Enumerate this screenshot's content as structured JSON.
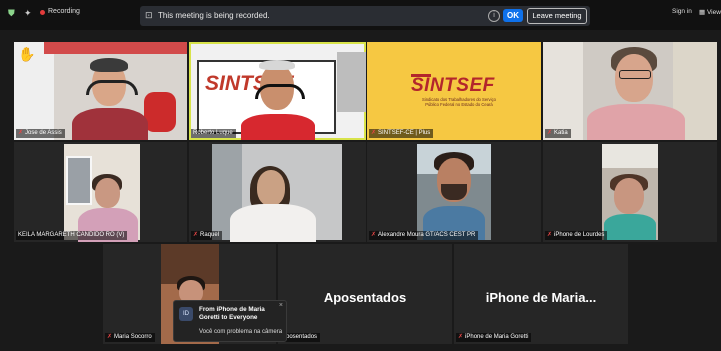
{
  "topbar": {
    "recording_label": "Recording",
    "banner_text": "This meeting is being recorded.",
    "ok_label": "OK",
    "leave_label": "Leave meeting",
    "signin_label": "Sign in",
    "view_label": "View"
  },
  "participants": [
    {
      "name": "Jose de Assis"
    },
    {
      "name": "Roberto Luque"
    },
    {
      "name": "SINTSEF-CE | Plus"
    },
    {
      "name": "Katia"
    },
    {
      "name": "KEILA MARGARETH CANDIDO RO (V)"
    },
    {
      "name": "Raquel"
    },
    {
      "name": "Alexandre Moura GT/ACS CEST PR"
    },
    {
      "name": "iPhone de Lourdes"
    },
    {
      "name": "Maria Socorro"
    },
    {
      "name": "Aposentados",
      "display": "Aposentados"
    },
    {
      "name": "iPhone de Maria Goretti",
      "display": "iPhone de Maria..."
    }
  ],
  "sintsef_card": {
    "brand": "SINTSEF",
    "sub1": "Sindicato dos Trabalhadores do Serviço",
    "sub2": "Público Federal no Estado do Ceará"
  },
  "poster_text": "SINTSEF",
  "chat": {
    "avatar": "ID",
    "from": "From iPhone de Maria Goretti to Everyone",
    "message": "Você com problema na câmera"
  },
  "colors": {
    "accent": "#0e71eb",
    "active_speaker": "#d8e34a",
    "sintsef_yellow": "#f6c842",
    "muted_mic": "#e64545"
  }
}
